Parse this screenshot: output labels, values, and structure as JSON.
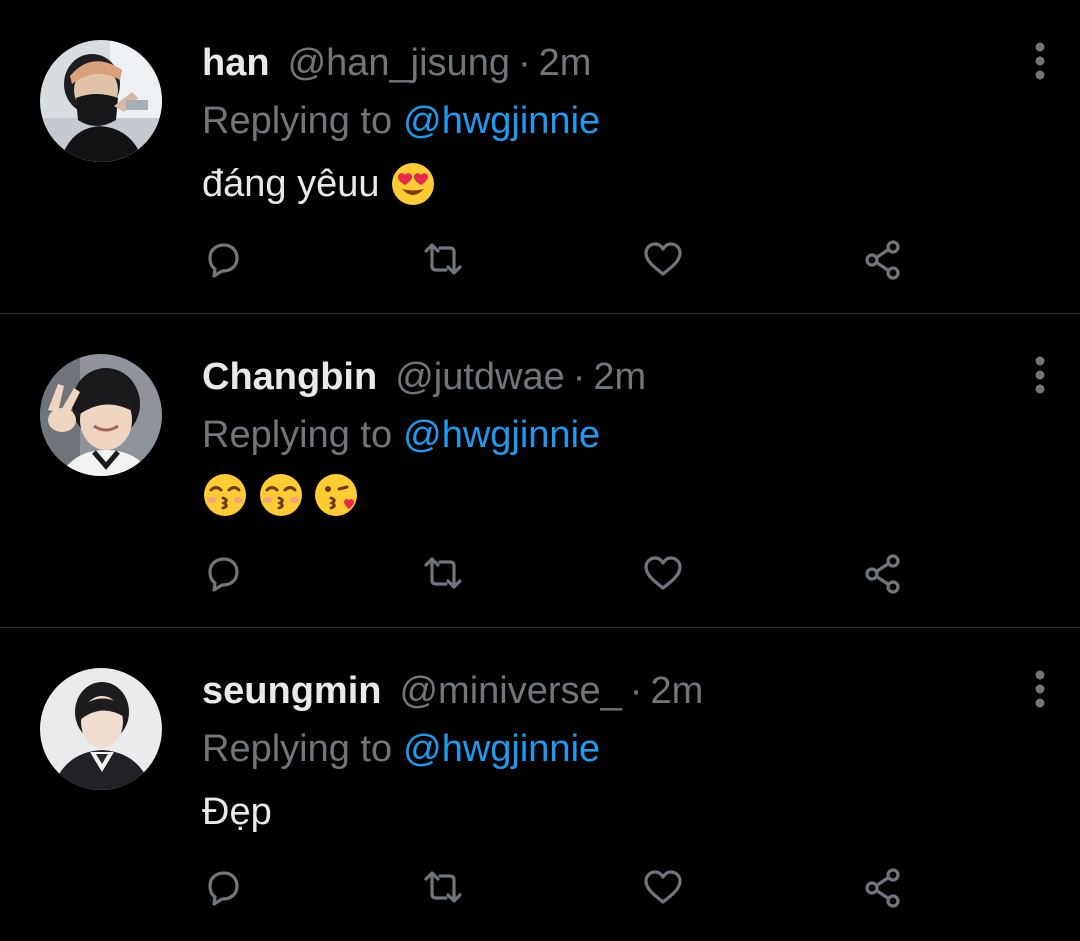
{
  "colors": {
    "background": "#000000",
    "text_primary": "#e7e9ea",
    "text_secondary": "#71767b",
    "accent": "#1d9bf0",
    "divider": "#2f3336",
    "icon": "#71767b"
  },
  "tweets": [
    {
      "display_name": "han",
      "handle": "@han_jisung",
      "separator": "·",
      "time": "2m",
      "reply_prefix": "Replying to",
      "reply_to": "@hwgjinnie",
      "text": "đáng yêuu",
      "emojis": [
        "heart-eyes-emoji"
      ],
      "avatar": "avatar-han"
    },
    {
      "display_name": "Changbin",
      "handle": "@jutdwae",
      "separator": "·",
      "time": "2m",
      "reply_prefix": "Replying to",
      "reply_to": "@hwgjinnie",
      "text": "",
      "emojis": [
        "kissing-smiling-eyes-emoji",
        "kissing-smiling-eyes-emoji",
        "face-blowing-kiss-emoji"
      ],
      "avatar": "avatar-changbin"
    },
    {
      "display_name": "seungmin",
      "handle": "@miniverse_",
      "separator": "·",
      "time": "2m",
      "reply_prefix": "Replying to",
      "reply_to": "@hwgjinnie",
      "text": "Đẹp",
      "emojis": [],
      "avatar": "avatar-seungmin"
    }
  ],
  "action_icons": [
    "reply-icon",
    "retweet-icon",
    "like-icon",
    "share-icon"
  ],
  "menu_icon": "more-options-icon"
}
